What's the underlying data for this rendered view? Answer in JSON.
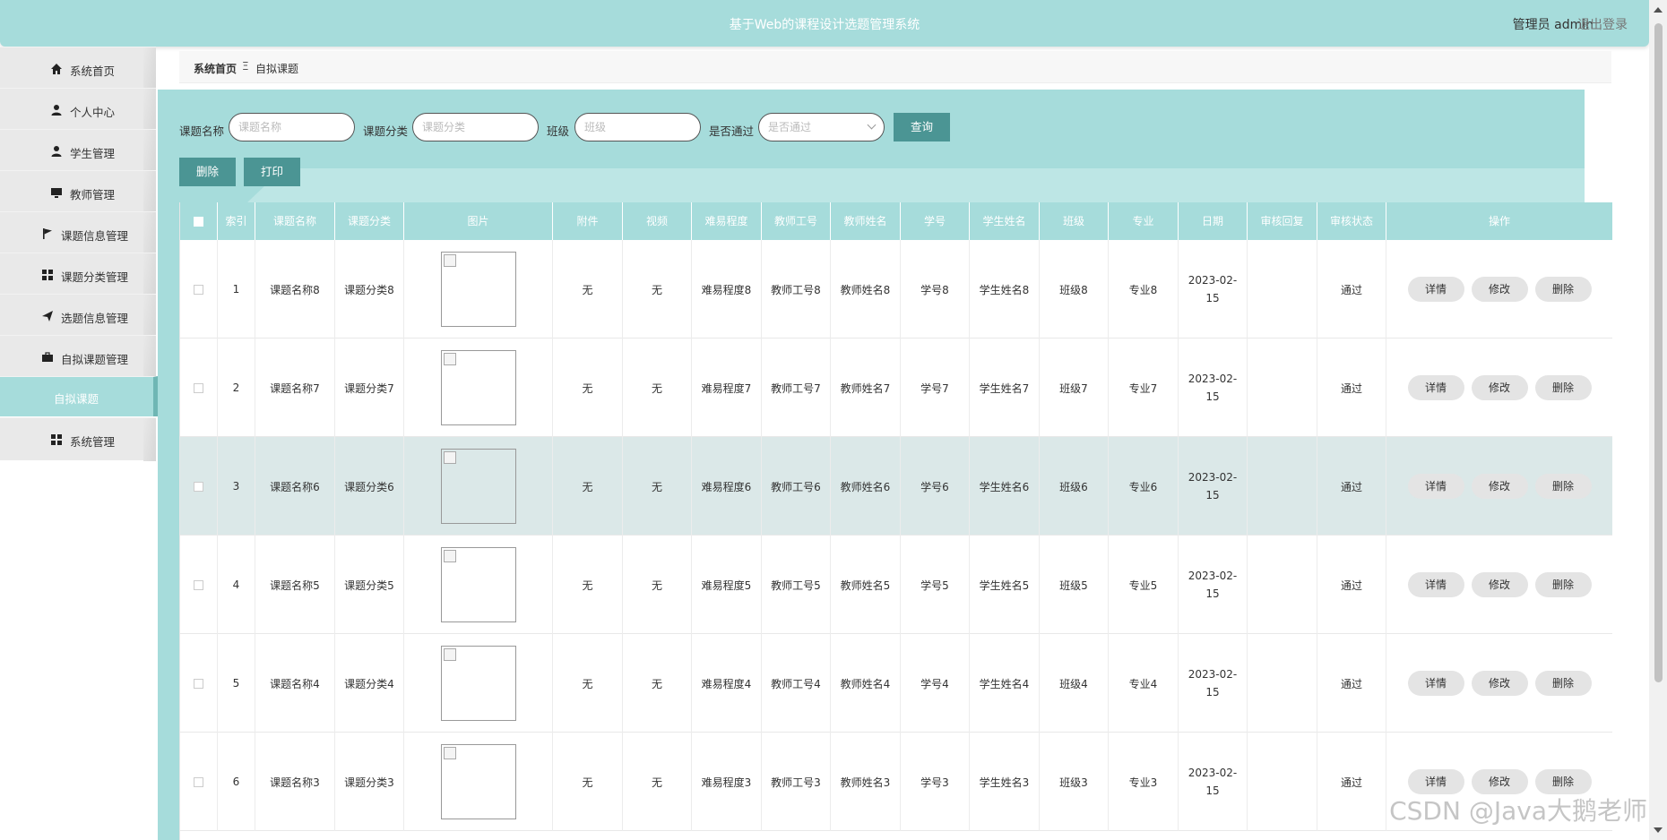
{
  "header": {
    "title": "基于Web的课程设计选题管理系统",
    "user": "管理员 admin",
    "logout": "退出登录"
  },
  "sidebar": {
    "items": [
      {
        "label": "系统首页",
        "icon": "home-icon"
      },
      {
        "label": "个人中心",
        "icon": "user-icon"
      },
      {
        "label": "学生管理",
        "icon": "user-icon"
      },
      {
        "label": "教师管理",
        "icon": "monitor-icon"
      },
      {
        "label": "课题信息管理",
        "icon": "flag-icon"
      },
      {
        "label": "课题分类管理",
        "icon": "grid-icon"
      },
      {
        "label": "选题信息管理",
        "icon": "send-icon"
      },
      {
        "label": "自拟课题管理",
        "icon": "briefcase-icon"
      },
      {
        "label": "自拟课题",
        "icon": ""
      },
      {
        "label": "系统管理",
        "icon": "grid-icon"
      }
    ]
  },
  "breadcrumb": {
    "home": "系统首页",
    "sep": "Ξ",
    "current": "自拟课题"
  },
  "search": {
    "name_label": "课题名称",
    "name_placeholder": "课题名称",
    "category_label": "课题分类",
    "category_placeholder": "课题分类",
    "class_label": "班级",
    "class_placeholder": "班级",
    "passed_label": "是否通过",
    "passed_placeholder": "是否通过",
    "query_button": "查询",
    "delete_button": "删除",
    "print_button": "打印"
  },
  "table": {
    "headers": [
      "索引",
      "课题名称",
      "课题分类",
      "图片",
      "附件",
      "视频",
      "难易程度",
      "教师工号",
      "教师姓名",
      "学号",
      "学生姓名",
      "班级",
      "专业",
      "日期",
      "审核回复",
      "审核状态",
      "操作"
    ],
    "rows": [
      {
        "index": "1",
        "name": "课题名称8",
        "category": "课题分类8",
        "attachment": "无",
        "video": "无",
        "difficulty": "难易程度8",
        "teacher_id": "教师工号8",
        "teacher_name": "教师姓名8",
        "student_id": "学号8",
        "student_name": "学生姓名8",
        "class": "班级8",
        "major": "专业8",
        "date": "2023-02-15",
        "reply": "",
        "status": "通过"
      },
      {
        "index": "2",
        "name": "课题名称7",
        "category": "课题分类7",
        "attachment": "无",
        "video": "无",
        "difficulty": "难易程度7",
        "teacher_id": "教师工号7",
        "teacher_name": "教师姓名7",
        "student_id": "学号7",
        "student_name": "学生姓名7",
        "class": "班级7",
        "major": "专业7",
        "date": "2023-02-15",
        "reply": "",
        "status": "通过"
      },
      {
        "index": "3",
        "name": "课题名称6",
        "category": "课题分类6",
        "attachment": "无",
        "video": "无",
        "difficulty": "难易程度6",
        "teacher_id": "教师工号6",
        "teacher_name": "教师姓名6",
        "student_id": "学号6",
        "student_name": "学生姓名6",
        "class": "班级6",
        "major": "专业6",
        "date": "2023-02-15",
        "reply": "",
        "status": "通过"
      },
      {
        "index": "4",
        "name": "课题名称5",
        "category": "课题分类5",
        "attachment": "无",
        "video": "无",
        "difficulty": "难易程度5",
        "teacher_id": "教师工号5",
        "teacher_name": "教师姓名5",
        "student_id": "学号5",
        "student_name": "学生姓名5",
        "class": "班级5",
        "major": "专业5",
        "date": "2023-02-15",
        "reply": "",
        "status": "通过"
      },
      {
        "index": "5",
        "name": "课题名称4",
        "category": "课题分类4",
        "attachment": "无",
        "video": "无",
        "difficulty": "难易程度4",
        "teacher_id": "教师工号4",
        "teacher_name": "教师姓名4",
        "student_id": "学号4",
        "student_name": "学生姓名4",
        "class": "班级4",
        "major": "专业4",
        "date": "2023-02-15",
        "reply": "",
        "status": "通过"
      },
      {
        "index": "6",
        "name": "课题名称3",
        "category": "课题分类3",
        "attachment": "无",
        "video": "无",
        "difficulty": "难易程度3",
        "teacher_id": "教师工号3",
        "teacher_name": "教师姓名3",
        "student_id": "学号3",
        "student_name": "学生姓名3",
        "class": "班级3",
        "major": "专业3",
        "date": "2023-02-15",
        "reply": "",
        "status": "通过"
      }
    ],
    "row_actions": {
      "detail": "详情",
      "edit": "修改",
      "delete": "删除"
    }
  },
  "watermark": "CSDN @Java大鹅老师",
  "colors": {
    "teal": "#a6dcdb",
    "teal_dark": "#4b9594",
    "row_highlight": "#dbe8e8"
  }
}
